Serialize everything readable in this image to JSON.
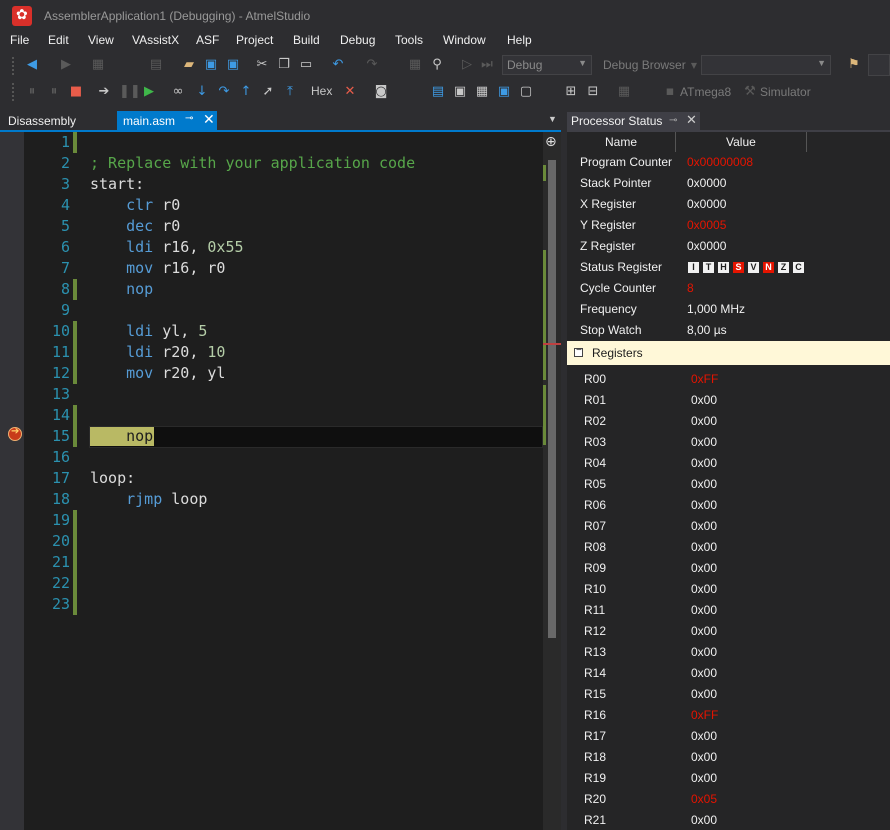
{
  "window": {
    "title": "AssemblerApplication1 (Debugging) - AtmelStudio",
    "logo_glyph": "✿"
  },
  "menu": [
    "File",
    "Edit",
    "View",
    "VAssistX",
    "ASF",
    "Project",
    "Build",
    "Debug",
    "Tools",
    "Window",
    "Help"
  ],
  "toolbar": {
    "config_combo": "Debug",
    "debug_browser_label": "Debug Browser",
    "hex_label": "Hex",
    "device_label": "ATmega8",
    "tool_label": "Simulator"
  },
  "tabs": {
    "disassembly": "Disassembly",
    "main_asm": "main.asm",
    "pin_glyph": "⊸",
    "close_glyph": "✕"
  },
  "editor": {
    "line_numbers": [
      "1",
      "2",
      "3",
      "4",
      "5",
      "6",
      "7",
      "8",
      "9",
      "10",
      "11",
      "12",
      "13",
      "14",
      "15",
      "16",
      "17",
      "18",
      "19",
      "20",
      "21",
      "22",
      "23"
    ],
    "lines": {
      "l2_comment": "; Replace with your application code",
      "l3_label": "start:",
      "l4_op": "clr",
      "l4_args": " r0",
      "l5_op": "dec",
      "l5_args": " r0",
      "l6_op": "ldi",
      "l6_args": " r16, ",
      "l6_num": "0x55",
      "l7_op": "mov",
      "l7_args": " r16, r0",
      "l8_op": "nop",
      "l10_op": "ldi",
      "l10_args": " yl, ",
      "l10_num": "5",
      "l11_op": "ldi",
      "l11_args": " r20, ",
      "l11_num": "10",
      "l12_op": "mov",
      "l12_args": " r20, yl",
      "l15_op": "nop",
      "l17_label": "loop:",
      "l18_op": "rjmp",
      "l18_args": " loop"
    }
  },
  "processor_status": {
    "title": "Processor Status",
    "col_name": "Name",
    "col_value": "Value",
    "properties": [
      {
        "name": "Program Counter",
        "value": "0x00000008",
        "changed": true
      },
      {
        "name": "Stack Pointer",
        "value": "0x0000",
        "changed": false
      },
      {
        "name": "X Register",
        "value": "0x0000",
        "changed": false
      },
      {
        "name": "Y Register",
        "value": "0x0005",
        "changed": true
      },
      {
        "name": "Z Register",
        "value": "0x0000",
        "changed": false
      },
      {
        "name": "Status Register",
        "value": "",
        "changed": false
      },
      {
        "name": "Cycle Counter",
        "value": "8",
        "changed": true
      },
      {
        "name": "Frequency",
        "value": "1,000 MHz",
        "changed": false
      },
      {
        "name": "Stop Watch",
        "value": "8,00 µs",
        "changed": false
      }
    ],
    "sreg_flags": [
      {
        "letter": "I",
        "set": false
      },
      {
        "letter": "T",
        "set": false
      },
      {
        "letter": "H",
        "set": false
      },
      {
        "letter": "S",
        "set": true
      },
      {
        "letter": "V",
        "set": false
      },
      {
        "letter": "N",
        "set": true
      },
      {
        "letter": "Z",
        "set": false
      },
      {
        "letter": "C",
        "set": false
      }
    ],
    "registers_label": "Registers",
    "registers": [
      {
        "name": "R00",
        "value": "0xFF",
        "changed": true
      },
      {
        "name": "R01",
        "value": "0x00",
        "changed": false
      },
      {
        "name": "R02",
        "value": "0x00",
        "changed": false
      },
      {
        "name": "R03",
        "value": "0x00",
        "changed": false
      },
      {
        "name": "R04",
        "value": "0x00",
        "changed": false
      },
      {
        "name": "R05",
        "value": "0x00",
        "changed": false
      },
      {
        "name": "R06",
        "value": "0x00",
        "changed": false
      },
      {
        "name": "R07",
        "value": "0x00",
        "changed": false
      },
      {
        "name": "R08",
        "value": "0x00",
        "changed": false
      },
      {
        "name": "R09",
        "value": "0x00",
        "changed": false
      },
      {
        "name": "R10",
        "value": "0x00",
        "changed": false
      },
      {
        "name": "R11",
        "value": "0x00",
        "changed": false
      },
      {
        "name": "R12",
        "value": "0x00",
        "changed": false
      },
      {
        "name": "R13",
        "value": "0x00",
        "changed": false
      },
      {
        "name": "R14",
        "value": "0x00",
        "changed": false
      },
      {
        "name": "R15",
        "value": "0x00",
        "changed": false
      },
      {
        "name": "R16",
        "value": "0xFF",
        "changed": true
      },
      {
        "name": "R17",
        "value": "0x00",
        "changed": false
      },
      {
        "name": "R18",
        "value": "0x00",
        "changed": false
      },
      {
        "name": "R19",
        "value": "0x00",
        "changed": false
      },
      {
        "name": "R20",
        "value": "0x05",
        "changed": true
      },
      {
        "name": "R21",
        "value": "0x00",
        "changed": false
      }
    ]
  },
  "colors": {
    "accent": "#007acc",
    "changed_value": "#e51400",
    "comment": "#57a64a",
    "keyword": "#569cd6",
    "line_number": "#2b91af",
    "current_statement": "#b9b964",
    "registers_header_bg": "#fff8d8"
  }
}
